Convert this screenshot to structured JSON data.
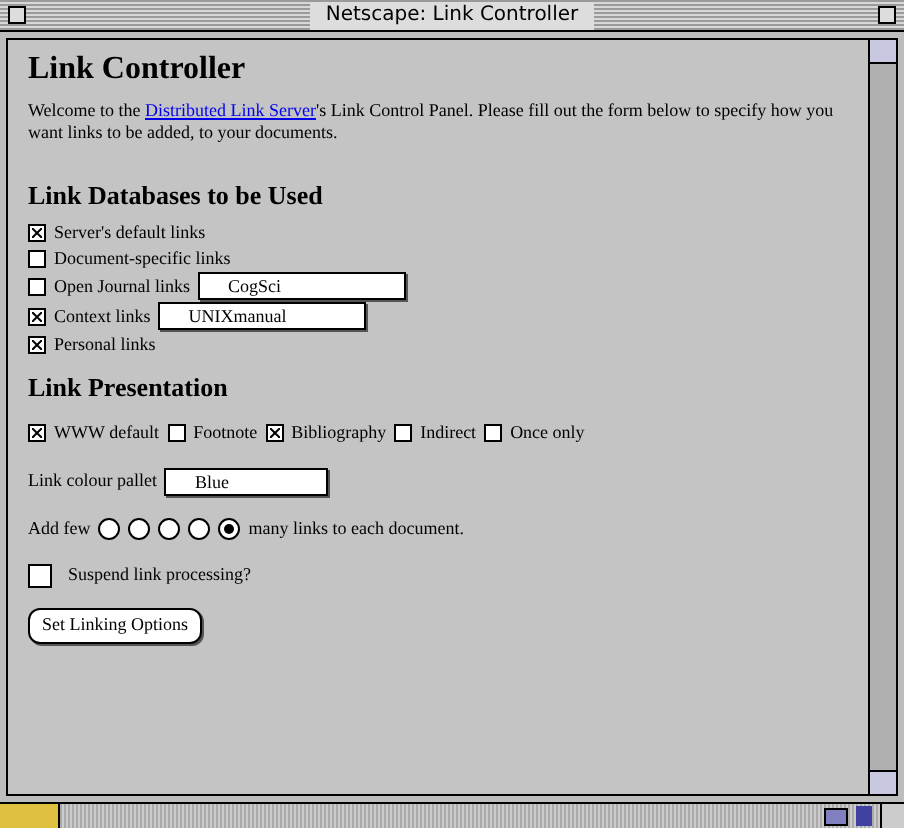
{
  "window": {
    "title": "Netscape: Link Controller"
  },
  "heading": "Link Controller",
  "intro": {
    "before": "Welcome to the ",
    "link": "Distributed Link Server",
    "after": "'s Link Control Panel. Please fill out the form below to specify how you want links to be added, to your documents."
  },
  "databases": {
    "heading": "Link Databases to be Used",
    "items": [
      {
        "label": "Server's default links",
        "checked": true
      },
      {
        "label": "Document-specific links",
        "checked": false
      },
      {
        "label": "Open Journal links",
        "checked": false,
        "value": "CogSci"
      },
      {
        "label": "Context links",
        "checked": true,
        "value": "UNIXmanual"
      },
      {
        "label": "Personal links",
        "checked": true
      }
    ]
  },
  "presentation": {
    "heading": "Link Presentation",
    "options": [
      {
        "label": "WWW default",
        "checked": true
      },
      {
        "label": "Footnote",
        "checked": false
      },
      {
        "label": "Bibliography",
        "checked": true
      },
      {
        "label": "Indirect",
        "checked": false
      },
      {
        "label": "Once only",
        "checked": false
      }
    ],
    "colour_label": "Link colour pallet",
    "colour_value": "Blue",
    "amount_before": "Add few",
    "amount_after": "many links to each document.",
    "amount": [
      {
        "selected": false
      },
      {
        "selected": false
      },
      {
        "selected": false
      },
      {
        "selected": false
      },
      {
        "selected": true
      }
    ],
    "suspend": {
      "label": "Suspend link processing?",
      "checked": false
    },
    "submit": "Set Linking Options"
  }
}
